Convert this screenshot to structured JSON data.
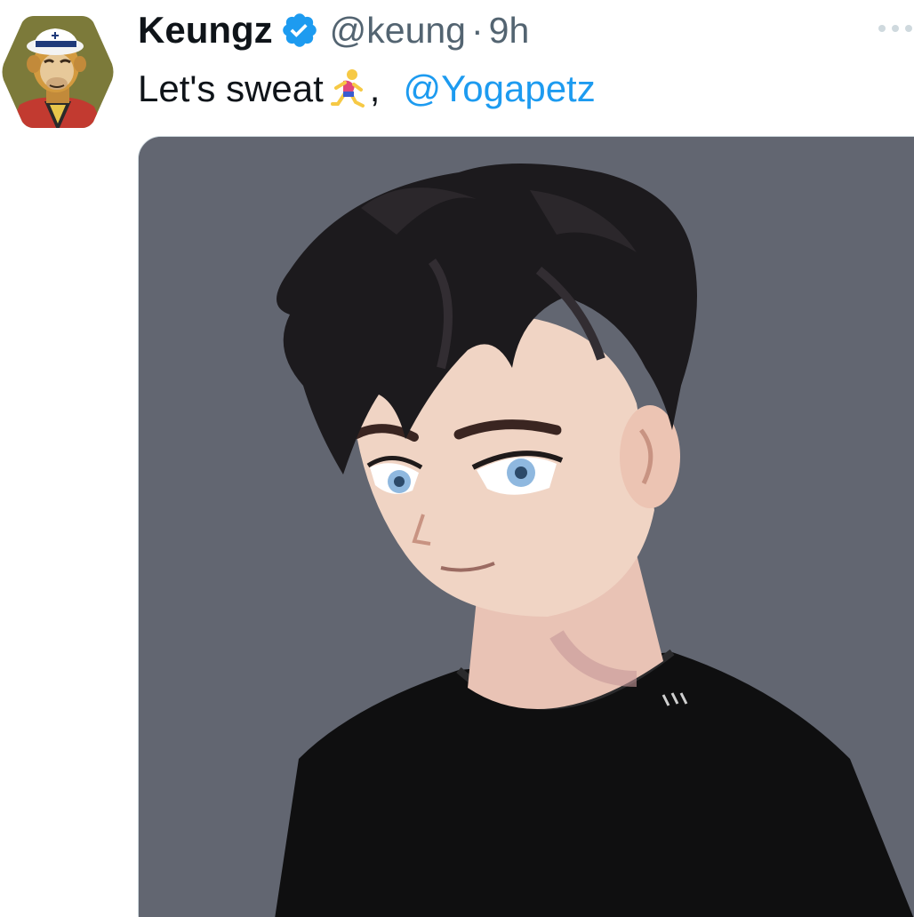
{
  "tweet": {
    "author": {
      "display_name": "Keungz",
      "handle": "@keung",
      "verified": true,
      "avatar_icon": "bored-ape-sailor-avatar"
    },
    "separator": "·",
    "time": "9h",
    "text": "Let's sweat",
    "emoji": "person-running-emoji",
    "punct": ",",
    "mention": "@Yogapetz",
    "media": {
      "kind": "image",
      "description_icon": "anime-boy-black-tshirt-illustration"
    }
  },
  "colors": {
    "text_primary": "#0f1419",
    "text_secondary": "#536471",
    "link": "#1d9bf0",
    "verified": "#1d9bf0",
    "media_bg": "#626671"
  }
}
